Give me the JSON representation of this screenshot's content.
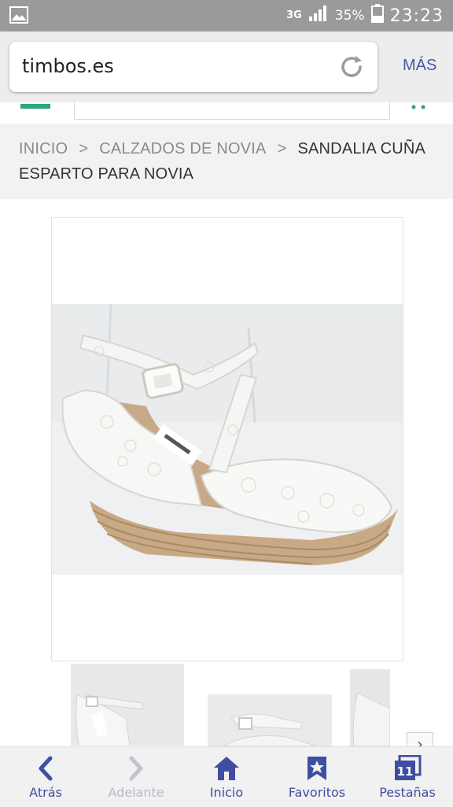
{
  "status_bar": {
    "network": "3G",
    "battery": "35%",
    "time": "23:23",
    "icons": [
      "gallery-icon",
      "signal-icon",
      "battery-icon"
    ]
  },
  "browser": {
    "url": "timbos.es",
    "more_label": "MÁS",
    "reload_icon": "reload-icon"
  },
  "breadcrumb": {
    "items": [
      "INICIO",
      "CALZADOS DE NOVIA",
      "SANDALIA CUÑA ESPARTO PARA NOVIA"
    ],
    "separator": ">"
  },
  "product": {
    "thumbnail_count": 3,
    "next_arrow": "›"
  },
  "bottom_nav": {
    "items": [
      {
        "label": "Atrás",
        "icon": "back-icon",
        "enabled": true
      },
      {
        "label": "Adelante",
        "icon": "forward-icon",
        "enabled": false
      },
      {
        "label": "Inicio",
        "icon": "home-icon",
        "enabled": true
      },
      {
        "label": "Favoritos",
        "icon": "bookmark-icon",
        "enabled": true
      },
      {
        "label": "Pestañas",
        "icon": "tabs-icon",
        "enabled": true,
        "badge": "11"
      }
    ]
  },
  "colors": {
    "accent": "#3f4ea0",
    "site_green": "#2aa67a",
    "status_bar": "#9a9a9a"
  }
}
